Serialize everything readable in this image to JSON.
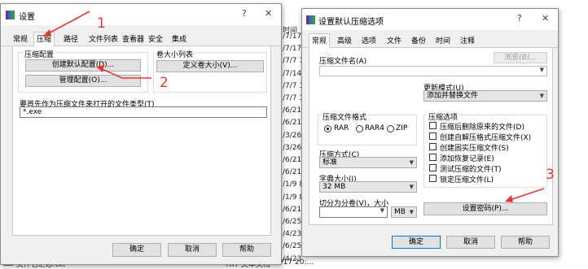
{
  "background": {
    "date_col": [
      "时间",
      "/7/17 1",
      "/7/17 1",
      "/7/7 11",
      "/7/14 1",
      "/7/7 11",
      "/7/7 11",
      "/6/21",
      "/6/21",
      "/3/26",
      "/3/26",
      "/6/21",
      "/6/21",
      "/1/9 8",
      "/1/9 8",
      "/6/21",
      "/6/25",
      "/4/23",
      "/6/25",
      "/4/23"
    ],
    "bottom_file": "文件名汇总.txt",
    "bottom_type": "TXT 文本文档",
    "bottom_date": "2023/2/17 20:..."
  },
  "dialog1": {
    "title": "设置",
    "help": "?",
    "close": "✕",
    "tabs": [
      "常规",
      "压缩",
      "路径",
      "文件列表",
      "查看器",
      "安全",
      "集成"
    ],
    "profiles_group": "压缩配置",
    "create_default_btn": "创建默认配置(D)...",
    "manage_btn": "管理配置(O)...",
    "volume_group": "卷大小列表",
    "define_volume_btn": "定义卷大小(V)...",
    "filetypes_label": "要首先作为压缩文件来打开的文件类型(T)",
    "filetypes_value": "*.exe",
    "ok": "确定",
    "cancel": "取消",
    "help_btn": "帮助"
  },
  "dialog2": {
    "title": "设置默认压缩选项",
    "help": "?",
    "close": "✕",
    "tabs": [
      "常规",
      "高级",
      "选项",
      "文件",
      "备份",
      "时间",
      "注释"
    ],
    "archive_name_label": "压缩文件名(A)",
    "browse_btn": "浏览(B)...",
    "update_mode_label": "更新模式(U)",
    "update_mode_value": "添加并替换文件",
    "format_group": "压缩文件格式",
    "formats": [
      "RAR",
      "RAR4",
      "ZIP"
    ],
    "method_label": "压缩方式(C)",
    "method_value": "标准",
    "dict_label": "字典大小(I)",
    "dict_value": "32 MB",
    "split_label": "切分为分卷(V)，大小",
    "split_unit": "MB",
    "options_group": "压缩选项",
    "options": [
      "压缩后删除原来的文件(D)",
      "创建自解压格式压缩文件(X)",
      "创建固实压缩文件(S)",
      "添加恢复记录(E)",
      "测试压缩的文件(T)",
      "锁定压缩文件(L)"
    ],
    "set_password_btn": "设置密码(P)...",
    "ok": "确定",
    "cancel": "取消",
    "help_btn": "帮助"
  },
  "annotations": {
    "n1": "1",
    "n2": "2",
    "n3": "3",
    "color": "#e53935"
  }
}
